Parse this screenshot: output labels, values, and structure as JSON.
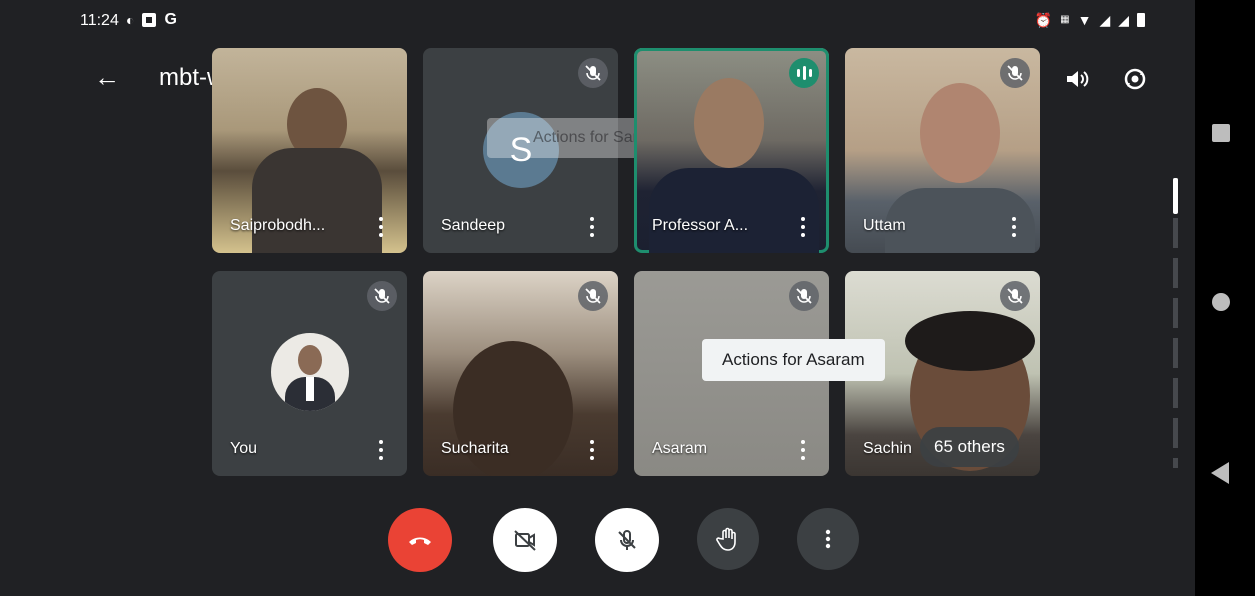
{
  "status_bar": {
    "time": "11:24",
    "left_icons": [
      "circle-half-icon",
      "photo-icon",
      "google-g-icon"
    ],
    "right_icons": [
      "alarm-icon",
      "volte-icon",
      "wifi-icon",
      "signal-icon",
      "signal-icon",
      "battery-icon"
    ]
  },
  "header": {
    "meeting_code": "mbt-wtbc-bpe"
  },
  "tiles": [
    {
      "name": "Saiprobodh...",
      "mic": "on"
    },
    {
      "name": "Sandeep",
      "avatar_letter": "S",
      "mic": "off"
    },
    {
      "name": "Professor A...",
      "mic": "speaking"
    },
    {
      "name": "Uttam",
      "mic": "off"
    },
    {
      "name": "You",
      "mic": "off"
    },
    {
      "name": "Sucharita",
      "mic": "off"
    },
    {
      "name": "Asaram",
      "mic": "off"
    },
    {
      "name": "Sachin",
      "mic": "off"
    }
  ],
  "tooltips": {
    "faded": "Actions for Sandeep",
    "active": "Actions for Asaram"
  },
  "others_chip": "65 others",
  "colors": {
    "background": "#202124",
    "end_call": "#ea4335",
    "speaking_border": "#1e8e6e",
    "tile_bg": "#3c4043"
  }
}
